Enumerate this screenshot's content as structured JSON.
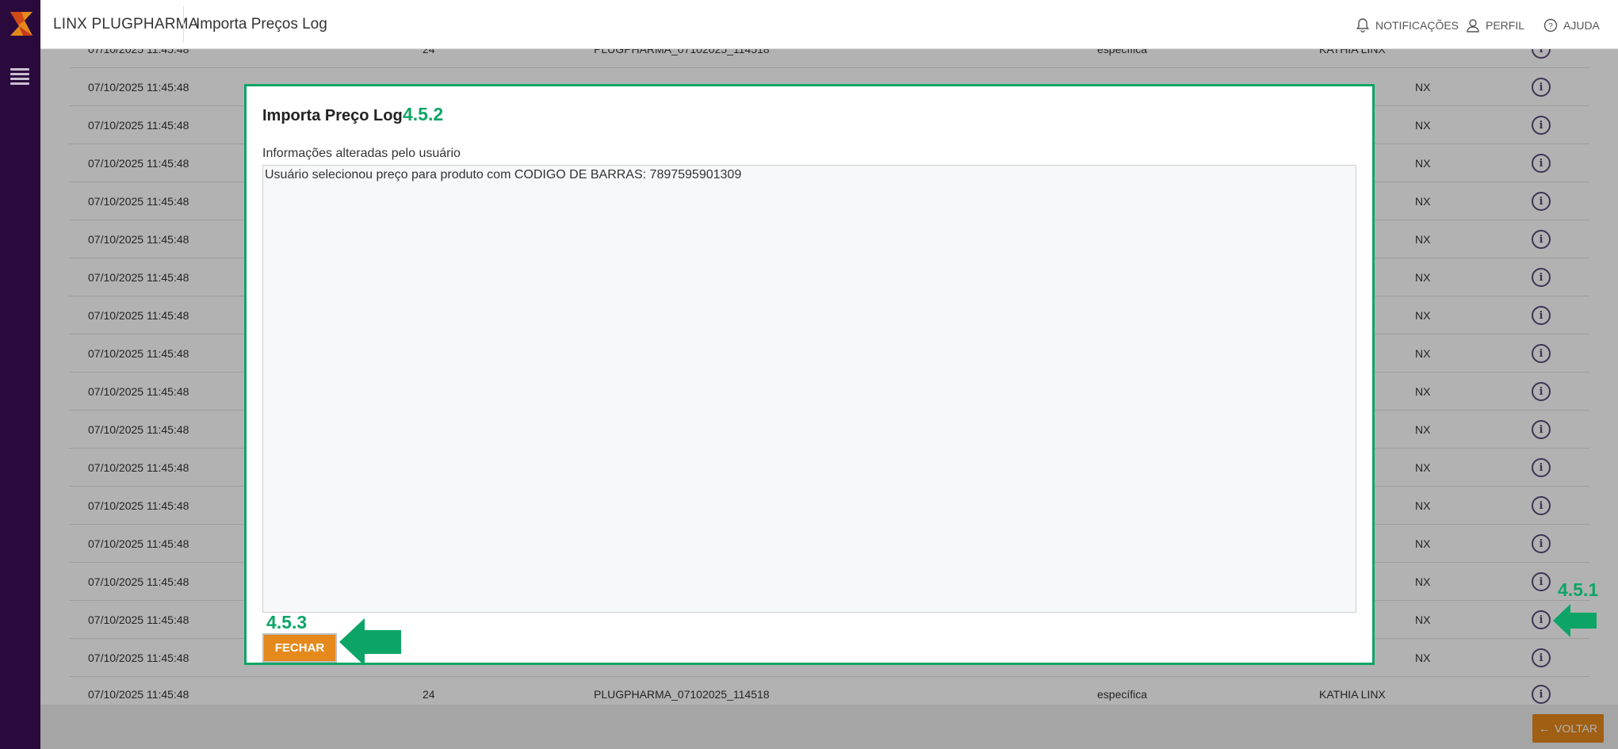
{
  "header": {
    "brand": "LINX PLUGPHARMA",
    "page_title": "Importa Preços Log",
    "notifications": "NOTIFICAÇÕES",
    "profile": "PERFIL",
    "help": "AJUDA"
  },
  "table": {
    "top_partial_row": {
      "date": "07/10/2025 11:45:48",
      "qty": "24",
      "file": "PLUGPHARMA_07102025_114518",
      "type": "específica",
      "user": "KATHIA LINX"
    },
    "rows": [
      {
        "date": "07/10/2025 11:45:48",
        "user_fragment": "NX"
      },
      {
        "date": "07/10/2025 11:45:48",
        "user_fragment": "NX"
      },
      {
        "date": "07/10/2025 11:45:48",
        "user_fragment": "NX"
      },
      {
        "date": "07/10/2025 11:45:48",
        "user_fragment": "NX"
      },
      {
        "date": "07/10/2025 11:45:48",
        "user_fragment": "NX"
      },
      {
        "date": "07/10/2025 11:45:48",
        "user_fragment": "NX"
      },
      {
        "date": "07/10/2025 11:45:48",
        "user_fragment": "NX"
      },
      {
        "date": "07/10/2025 11:45:48",
        "user_fragment": "NX"
      },
      {
        "date": "07/10/2025 11:45:48",
        "user_fragment": "NX"
      },
      {
        "date": "07/10/2025 11:45:48",
        "user_fragment": "NX"
      },
      {
        "date": "07/10/2025 11:45:48",
        "user_fragment": "NX"
      },
      {
        "date": "07/10/2025 11:45:48",
        "user_fragment": "NX"
      },
      {
        "date": "07/10/2025 11:45:48",
        "user_fragment": "NX"
      },
      {
        "date": "07/10/2025 11:45:48",
        "user_fragment": "NX"
      },
      {
        "date": "07/10/2025 11:45:48",
        "user_fragment": "NX"
      },
      {
        "date": "07/10/2025 11:45:48",
        "user_fragment": "NX"
      }
    ],
    "last_row": {
      "date": "07/10/2025 11:45:48",
      "qty": "24",
      "file": "PLUGPHARMA_07102025_114518",
      "type": "específica",
      "user": "KATHIA LINX"
    },
    "info_icon_glyph": "i"
  },
  "modal": {
    "title": "Importa Preço Log",
    "step_tag": "4.5.2",
    "field_label": "Informações alteradas pelo usuário",
    "log_text": "Usuário selecionou preço para produto com CODIGO DE BARRAS: 7897595901309",
    "close_label": "FECHAR"
  },
  "annotations": {
    "info_step": "4.5.1",
    "close_step": "4.5.3",
    "color": "#0da567"
  },
  "footer": {
    "back_label": "VOLTAR",
    "back_icon": "←"
  },
  "colors": {
    "sidebar": "#2a0a3d",
    "accent_orange": "#e5891c",
    "annotation_green": "#0da567"
  }
}
